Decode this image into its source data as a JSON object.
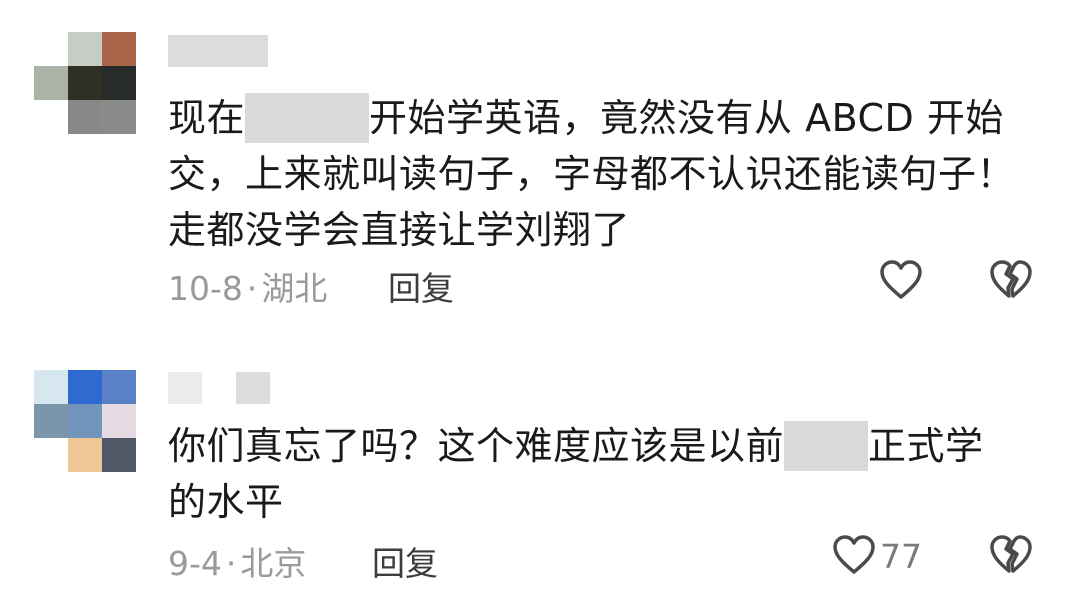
{
  "comments": [
    {
      "text_before": "现在",
      "text_after": "开始学英语，竟然没有从 ABCD 开始交，上来就叫读句子，字母都不认识还能读句子！走都没学会直接让学刘翔了",
      "date": "10-8",
      "separator": "·",
      "location": "湖北",
      "reply_label": "回复",
      "like_icon": "heart-outline-icon",
      "dislike_icon": "broken-heart-icon"
    },
    {
      "text_before": "你们真忘了吗？这个难度应该是以前",
      "text_after": "正式学的水平",
      "date": "9-4",
      "separator": "·",
      "location": "北京",
      "reply_label": "回复",
      "like_count": "77",
      "like_icon": "heart-outline-icon",
      "dislike_icon": "broken-heart-icon"
    }
  ],
  "colors": {
    "text": "#1a1a1a",
    "meta": "#9a9a9a",
    "icon": "#4a4a4a"
  }
}
